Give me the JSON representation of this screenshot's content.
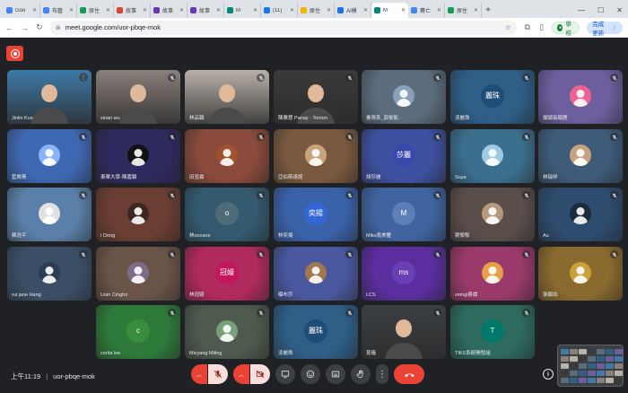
{
  "browser": {
    "tabs": [
      {
        "label": "Goo",
        "fav": "#4285f4",
        "active": false
      },
      {
        "label": "布藝",
        "fav": "#4285f4",
        "active": false
      },
      {
        "label": "原住",
        "fav": "#0f9d58",
        "active": false
      },
      {
        "label": "故事",
        "fav": "#db4437",
        "active": false
      },
      {
        "label": "故事",
        "fav": "#673ab7",
        "active": false
      },
      {
        "label": "故事",
        "fav": "#673ab7",
        "active": false
      },
      {
        "label": "M",
        "fav": "#00897b",
        "active": false
      },
      {
        "label": "(11)",
        "fav": "#1877f2",
        "active": false
      },
      {
        "label": "原住",
        "fav": "#f4b400",
        "active": false
      },
      {
        "label": "AI模",
        "fav": "#1a73e8",
        "active": false
      },
      {
        "label": "M",
        "fav": "#00897b",
        "active": true
      },
      {
        "label": "賽亡",
        "fav": "#4285f4",
        "active": false
      },
      {
        "label": "原住",
        "fav": "#0f9d58",
        "active": false
      }
    ],
    "new_tab_symbol": "+",
    "url": "meet.google.com/uor-pbqe-mok",
    "profile_label": "學校",
    "update_label": "完成更新"
  },
  "meeting": {
    "time": "上午11:19",
    "code": "uor-pbqe-mok"
  },
  "participants": [
    {
      "name": "Jinlin Kuo",
      "bg": "#3d7aa8",
      "kind": "video",
      "muted": false,
      "speaking": true
    },
    {
      "name": "xinan wu",
      "bg": "#8a7f7a",
      "kind": "video",
      "muted": true
    },
    {
      "name": "林品穎",
      "bg": "#b8b2a8",
      "kind": "video",
      "muted": true
    },
    {
      "name": "陳雅慧 Panay · Tomon",
      "bg": "#3a3a3a",
      "kind": "video",
      "muted": true
    },
    {
      "name": "臺灣系_郭俊凱",
      "bg": "#5b6c7c",
      "kind": "avatar",
      "avatar_color": "#8aa0b8",
      "muted": true
    },
    {
      "name": "淩麗珠",
      "bg": "#2f5e86",
      "kind": "initials",
      "initials": "麗珠",
      "avatar_color": "#1e4e78",
      "muted": true
    },
    {
      "name": "瑚瑚長頸鹿",
      "bg": "#6d5f9e",
      "kind": "avatar",
      "avatar_color": "#f06292",
      "muted": true
    },
    {
      "name": "藍姵菁",
      "bg": "#3f68b2",
      "kind": "avatar",
      "avatar_color": "#8ab4f8",
      "muted": true
    },
    {
      "name": "東華大學-陳嘉穎",
      "bg": "#2f2a5e",
      "kind": "avatar",
      "avatar_color": "#111111",
      "muted": true
    },
    {
      "name": "田昱霖",
      "bg": "#8a4a3c",
      "kind": "avatar",
      "avatar_color": "#a0522d",
      "muted": true
    },
    {
      "name": "亞伯斯達諾",
      "bg": "#7a5a3e",
      "kind": "avatar",
      "avatar_color": "#c8a27a",
      "muted": true
    },
    {
      "name": "胡莎麗",
      "bg": "#3d51a0",
      "kind": "initials",
      "initials": "莎麗",
      "avatar_color": "#3949ab",
      "muted": true
    },
    {
      "name": "Suya",
      "bg": "#3b6f8e",
      "kind": "avatar",
      "avatar_color": "#9ecae1",
      "muted": true
    },
    {
      "name": "林瑞祥",
      "bg": "#3e5c7a",
      "kind": "avatar",
      "avatar_color": "#c7a37f",
      "muted": true
    },
    {
      "name": "蘇浩平",
      "bg": "#5a7fa8",
      "kind": "avatar",
      "avatar_color": "#e0e0e0",
      "muted": true
    },
    {
      "name": "I Dong",
      "bg": "#6b3e33",
      "kind": "avatar",
      "avatar_color": "#3e2723",
      "muted": true
    },
    {
      "name": "林oceane",
      "bg": "#335a6e",
      "kind": "initials",
      "initials": "o",
      "avatar_color": "#4f6b7a",
      "muted": true
    },
    {
      "name": "林奕揚",
      "bg": "#3a62a8",
      "kind": "initials",
      "initials": "奕揚",
      "avatar_color": "#3367d6",
      "muted": true
    },
    {
      "name": "Miko馬美雁",
      "bg": "#3f64a0",
      "kind": "initials",
      "initials": "M",
      "avatar_color": "#5c7fb8",
      "muted": true
    },
    {
      "name": "劉黎郁",
      "bg": "#5a4e4a",
      "kind": "avatar",
      "avatar_color": "#b59a7a",
      "muted": true
    },
    {
      "name": "Au",
      "bg": "#2e4c6e",
      "kind": "avatar",
      "avatar_color": "#1c2c3e",
      "muted": true
    },
    {
      "name": "rui jane Hang",
      "bg": "#3a4f66",
      "kind": "avatar",
      "avatar_color": "#2b3d52",
      "muted": true
    },
    {
      "name": "Lisin Cingho",
      "bg": "#6a5448",
      "kind": "avatar",
      "avatar_color": "#7d6b8a",
      "muted": true
    },
    {
      "name": "林冠嫚",
      "bg": "#b02a5e",
      "kind": "initials",
      "initials": "冠嫚",
      "avatar_color": "#c2185b",
      "muted": true
    },
    {
      "name": "曝布莎",
      "bg": "#4a58a0",
      "kind": "avatar",
      "avatar_color": "#a07850",
      "muted": true
    },
    {
      "name": "LCS",
      "bg": "#5a2e9e",
      "kind": "initials",
      "initials": "ms",
      "avatar_color": "#6a3fb5",
      "muted": true
    },
    {
      "name": "veingi蔣甫",
      "bg": "#9a3a6a",
      "kind": "avatar",
      "avatar_color": "#e6a04a",
      "muted": true
    },
    {
      "name": "張穎如",
      "bg": "#8a6a2e",
      "kind": "avatar",
      "avatar_color": "#c9a03a",
      "muted": true
    },
    {
      "name": "cerita lee",
      "bg": "#2e7a3a",
      "kind": "initials",
      "initials": "c",
      "avatar_color": "#388e3c",
      "muted": true
    },
    {
      "name": "Micyang Miling",
      "bg": "#4e5a4e",
      "kind": "avatar",
      "avatar_color": "#78a078",
      "muted": true
    },
    {
      "name": "淩麗珠",
      "bg": "#2f5e86",
      "kind": "initials",
      "initials": "麗珠",
      "avatar_color": "#1e4e78",
      "muted": true
    },
    {
      "name": "蔦儀",
      "bg": "#3c4043",
      "kind": "video",
      "muted": true
    },
    {
      "name": "TIKS系統開發組",
      "bg": "#2e6a5e",
      "kind": "initials",
      "initials": "T",
      "avatar_color": "#00796b",
      "muted": true
    }
  ],
  "icons": {
    "record": "record-icon",
    "mic_off": "mic-off-icon",
    "cam_off": "camera-off-icon",
    "present": "present-icon",
    "emoji": "emoji-icon",
    "captions": "captions-icon",
    "hand": "raise-hand-icon",
    "more": "more-vert-icon",
    "leave": "leave-call-icon",
    "info": "info-icon"
  },
  "info_symbol": "i",
  "more_symbol": "⋮"
}
